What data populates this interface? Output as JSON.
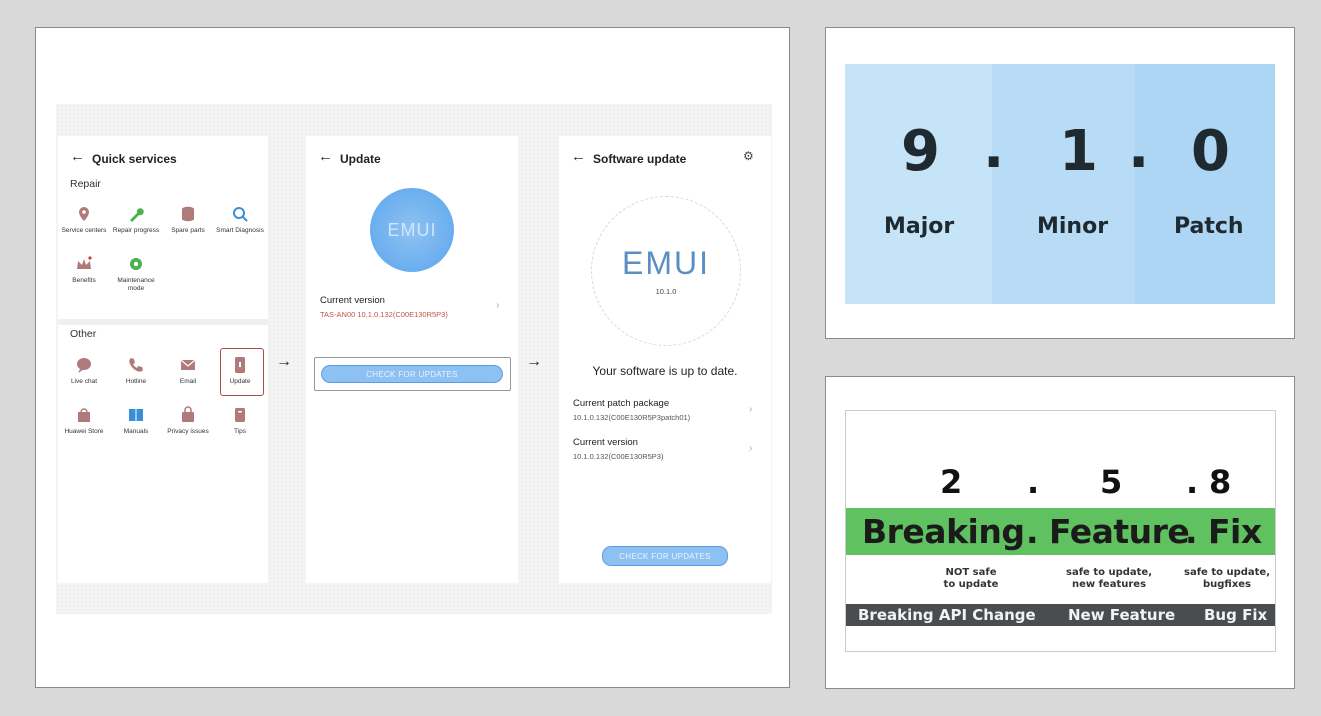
{
  "left": {
    "quick_services": {
      "title": "Quick services",
      "repair_label": "Repair",
      "repair_items": [
        {
          "label": "Service centers",
          "icon": "location-pin-icon",
          "color": "#b07a7a"
        },
        {
          "label": "Repair progress",
          "icon": "wrench-icon",
          "color": "#4caf50"
        },
        {
          "label": "Spare parts",
          "icon": "database-icon",
          "color": "#b07a7a"
        },
        {
          "label": "Smart Diagnosis",
          "icon": "magnifier-icon",
          "color": "#3a8fd8"
        },
        {
          "label": "Benefits",
          "icon": "crown-icon",
          "color": "#b07a7a"
        },
        {
          "label": "Maintenance mode",
          "icon": "gear-shield-icon",
          "color": "#4caf50"
        }
      ],
      "other_label": "Other",
      "other_items": [
        {
          "label": "Live chat",
          "icon": "chat-bubble-icon",
          "color": "#b07a7a"
        },
        {
          "label": "Hotline",
          "icon": "phone-icon",
          "color": "#b07a7a"
        },
        {
          "label": "Email",
          "icon": "envelope-icon",
          "color": "#b07a7a"
        },
        {
          "label": "Update",
          "icon": "phone-update-icon",
          "color": "#b07a7a"
        },
        {
          "label": "Huawei Store",
          "icon": "store-icon",
          "color": "#b07a7a"
        },
        {
          "label": "Manuals",
          "icon": "book-icon",
          "color": "#3a8fd8"
        },
        {
          "label": "Privacy issues",
          "icon": "bag-lock-icon",
          "color": "#b07a7a"
        },
        {
          "label": "Tips",
          "icon": "tips-icon",
          "color": "#b07a7a"
        }
      ]
    },
    "update": {
      "title": "Update",
      "logo_text": "EMUI",
      "current_version_label": "Current version",
      "current_version_value": "TAS-AN00 10.1.0.132(C00E130R5P3)",
      "check_button": "CHECK FOR UPDATES"
    },
    "software_update": {
      "title": "Software update",
      "logo_text": "EMUI",
      "logo_version": "10.1.0",
      "status": "Your software is up to date.",
      "patch_label": "Current patch package",
      "patch_value": "10.1.0.132(C00E130R5P3patch01)",
      "version_label": "Current version",
      "version_value": "10.1.0.132(C00E130R5P3)",
      "check_button": "CHECK FOR UPDATES"
    },
    "arrow": "→"
  },
  "version_card": {
    "major": "9",
    "minor": "1",
    "patch": "0",
    "dot": ".",
    "major_label": "Major",
    "minor_label": "Minor",
    "patch_label": "Patch",
    "colors": {
      "major": "#c5e4f7",
      "minor": "#b8dcf5",
      "patch": "#acd6f3"
    }
  },
  "semver_card": {
    "major": "2",
    "minor": "5",
    "patch": "8",
    "dot": ".",
    "breaking": "Breaking",
    "feature": "Feature",
    "fix": "Fix",
    "not_safe": "NOT safe\nto update",
    "safe_features": "safe to update,\nnew features",
    "safe_bugfixes": "safe to update,\nbugfixes",
    "breaking_api": "Breaking API Change",
    "new_feature": "New Feature",
    "bug_fix": "Bug Fix",
    "colors": {
      "green": "#5fc15f",
      "grey": "#4a4d50"
    }
  }
}
